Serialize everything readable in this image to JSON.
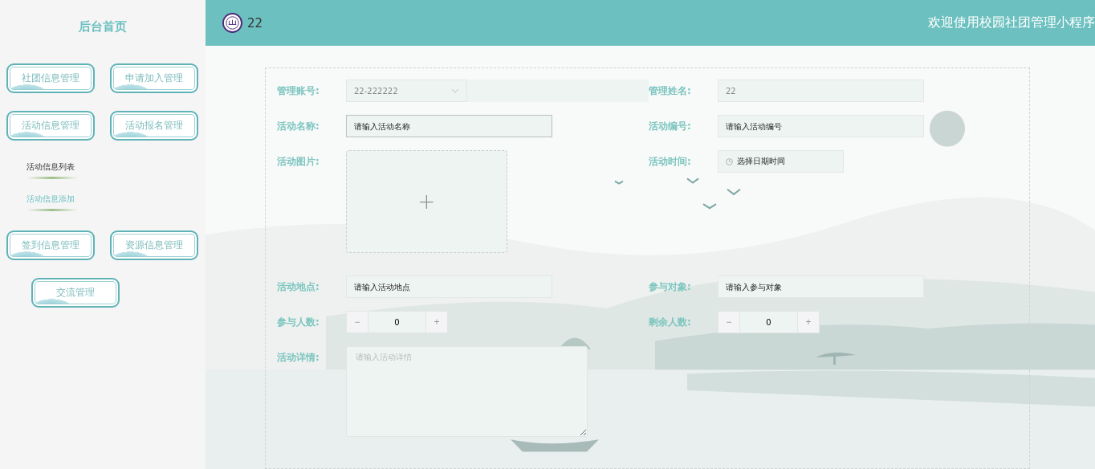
{
  "sidebar": {
    "title": "后台首页",
    "menu": [
      {
        "label": "社团信息管理"
      },
      {
        "label": "申请加入管理"
      },
      {
        "label": "活动信息管理",
        "children": [
          {
            "label": "活动信息列表",
            "selected": false
          },
          {
            "label": "活动信息添加",
            "selected": true
          }
        ]
      },
      {
        "label": "活动报名管理"
      },
      {
        "label": "签到信息管理"
      },
      {
        "label": "资源信息管理"
      },
      {
        "label": "交流管理"
      }
    ]
  },
  "header": {
    "user": "22",
    "title": "欢迎使用校园社团管理小程序"
  },
  "form": {
    "fields": [
      {
        "kind": "select",
        "label": "管理账号:",
        "value": "22-222222",
        "disabled": true
      },
      {
        "kind": "text",
        "label": "管理姓名:",
        "value": "22",
        "disabled": true
      },
      {
        "kind": "text",
        "label": "活动名称:",
        "placeholder": "请输入活动名称",
        "focused": true
      },
      {
        "kind": "text",
        "label": "活动编号:",
        "placeholder": "请输入活动编号",
        "focused": false
      },
      {
        "kind": "upload",
        "label": "活动图片:",
        "icon": "+"
      },
      {
        "kind": "datetime",
        "label": "活动时间:",
        "placeholder": "选择日期时间"
      },
      {
        "kind": "text",
        "label": "活动地点:",
        "placeholder": "请输入活动地点",
        "focused": false
      },
      {
        "kind": "text",
        "label": "参与对象:",
        "placeholder": "请输入参与对象",
        "focused": false
      },
      {
        "kind": "number",
        "label": "参与人数:",
        "value": "0",
        "minus": "−",
        "plus": "+"
      },
      {
        "kind": "number",
        "label": "剩余人数:",
        "value": "0",
        "minus": "−",
        "plus": "+"
      },
      {
        "kind": "textarea",
        "label": "活动详情:",
        "placeholder": "请输入活动详情"
      }
    ]
  }
}
